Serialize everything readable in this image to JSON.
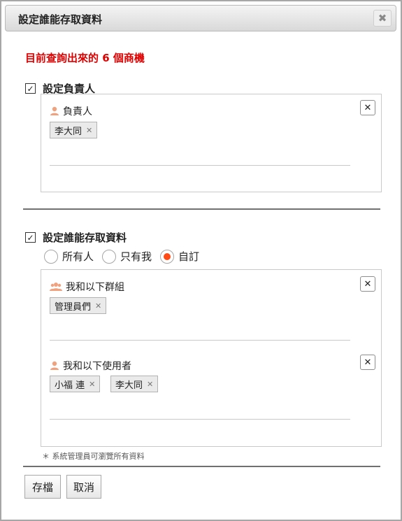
{
  "dialog": {
    "title": "設定誰能存取資料",
    "close_symbol": "✖"
  },
  "headline": "目前查詢出來的 6 個商機",
  "owner_section": {
    "checkbox_label": "設定負責人",
    "checked": true,
    "field_label": "負責人",
    "tags": [
      "李大同"
    ],
    "remove_symbol": "✕"
  },
  "access_section": {
    "checkbox_label": "設定誰能存取資料",
    "checked": true,
    "radio_options": [
      "所有人",
      "只有我",
      "自訂"
    ],
    "selected_option": "自訂",
    "groups_label": "我和以下群組",
    "group_tags": [
      "管理員們"
    ],
    "users_label": "我和以下使用者",
    "user_tags": [
      "小福 連",
      "李大同"
    ],
    "remove_symbol": "✕"
  },
  "note": "＊ 系統管理員可瀏覽所有資料",
  "buttons": {
    "save": "存檔",
    "cancel": "取消"
  },
  "colors": {
    "headline": "#e00000",
    "accent": "#ff4a16",
    "user_icon": "#f0a27f"
  }
}
